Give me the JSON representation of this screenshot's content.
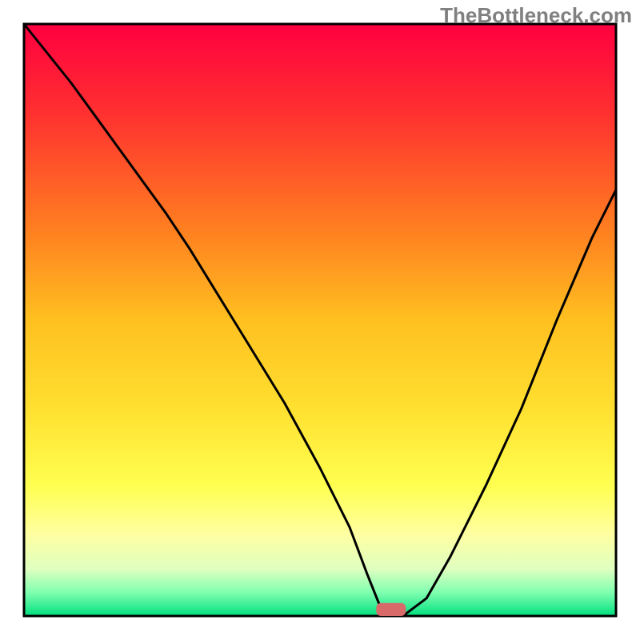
{
  "watermark": "TheBottleneck.com",
  "chart_data": {
    "type": "line",
    "title": "",
    "xlabel": "",
    "ylabel": "",
    "xlim": [
      0,
      100
    ],
    "ylim": [
      0,
      100
    ],
    "legend": false,
    "axes_visible": true,
    "background_gradient": {
      "stops": [
        {
          "offset": 0.0,
          "color": "#ff0040"
        },
        {
          "offset": 0.15,
          "color": "#ff3030"
        },
        {
          "offset": 0.35,
          "color": "#ff8020"
        },
        {
          "offset": 0.5,
          "color": "#ffc020"
        },
        {
          "offset": 0.65,
          "color": "#ffe030"
        },
        {
          "offset": 0.78,
          "color": "#ffff50"
        },
        {
          "offset": 0.86,
          "color": "#ffffa0"
        },
        {
          "offset": 0.92,
          "color": "#e0ffc0"
        },
        {
          "offset": 0.96,
          "color": "#80ffb0"
        },
        {
          "offset": 1.0,
          "color": "#00e080"
        }
      ]
    },
    "series": [
      {
        "name": "curve",
        "color": "#000000",
        "x": [
          0,
          8,
          16,
          24,
          28,
          36,
          44,
          50,
          55,
          58,
          60,
          62,
          64,
          68,
          72,
          78,
          84,
          90,
          96,
          100
        ],
        "y": [
          100,
          90,
          79,
          68,
          62,
          49,
          36,
          25,
          15,
          7,
          2,
          0,
          0,
          3,
          10,
          22,
          35,
          50,
          64,
          72
        ]
      }
    ],
    "marker": {
      "x": 62,
      "y": 0,
      "color": "#d86a6a",
      "width": 5,
      "height": 2.2,
      "shape": "rounded-rect"
    }
  }
}
